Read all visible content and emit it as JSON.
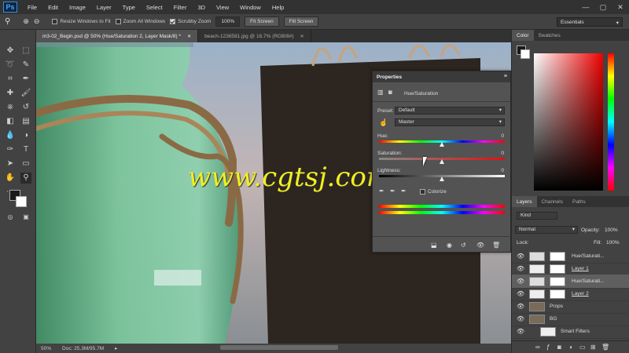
{
  "app": {
    "logo": "Ps"
  },
  "menu": [
    "File",
    "Edit",
    "Image",
    "Layer",
    "Type",
    "Select",
    "Filter",
    "3D",
    "View",
    "Window",
    "Help"
  ],
  "window_controls": {
    "minimize": "—",
    "maximize": "▢",
    "close": "✕"
  },
  "options": {
    "resize_windows": "Resize Windows to Fit",
    "zoom_all": "Zoom All Windows",
    "scrubby_zoom": "Scrubby Zoom",
    "zoom_value": "100%",
    "fit_screen": "Fit Screen",
    "fill_screen": "Fill Screen",
    "workspace": "Essentials"
  },
  "tabs": [
    {
      "label": "m3-02_Begin.psd @ 50% (Hue/Saturation 2, Layer Mask/8) *",
      "close": "✕"
    },
    {
      "label": "beach-1236581.jpg @ 16.7% (RGB/8#)",
      "close": "✕"
    }
  ],
  "watermark": "www.cgtsj.com",
  "status": {
    "zoom": "50%",
    "doc": "Doc: 25.3M/95.7M"
  },
  "properties": {
    "title": "Properties",
    "adjustment": "Hue/Saturation",
    "preset_label": "Preset:",
    "preset_value": "Default",
    "channel_value": "Master",
    "hue_label": "Hue:",
    "hue_value": "0",
    "saturation_label": "Saturation:",
    "saturation_value": "0",
    "lightness_label": "Lightness:",
    "lightness_value": "0",
    "colorize_label": "Colorize",
    "hue_fraction": 0.5,
    "saturation_fraction": 0.5,
    "lightness_fraction": 0.5
  },
  "color_panel": {
    "tabs": [
      "Color",
      "Swatches"
    ]
  },
  "layers_panel": {
    "tabs": [
      "Layers",
      "Channels",
      "Paths"
    ],
    "kind": "Kind",
    "blend": "Normal",
    "opacity_label": "Opacity:",
    "opacity_value": "100%",
    "lock_label": "Lock:",
    "fill_label": "Fill:",
    "fill_value": "100%",
    "layers": [
      {
        "name": "Hue/Saturati...",
        "type": "adjustment",
        "selected": false
      },
      {
        "name": "Layer 1",
        "type": "pixel",
        "selected": false
      },
      {
        "name": "Hue/Saturati...",
        "type": "adjustment",
        "selected": true
      },
      {
        "name": "Layer 2",
        "type": "pixel",
        "selected": false
      },
      {
        "name": "Props",
        "type": "image",
        "selected": false
      },
      {
        "name": "BG",
        "type": "image",
        "selected": false
      },
      {
        "name": "Smart Filters",
        "type": "filter",
        "selected": false
      }
    ],
    "footer_icons": [
      "link-icon",
      "fx-icon",
      "mask-icon",
      "adjustment-icon",
      "folder-icon",
      "new-layer-icon",
      "trash-icon"
    ]
  },
  "colors": {
    "accent": "#f0f020",
    "selected_layer": "#5f5f5f",
    "panel": "#535353"
  }
}
